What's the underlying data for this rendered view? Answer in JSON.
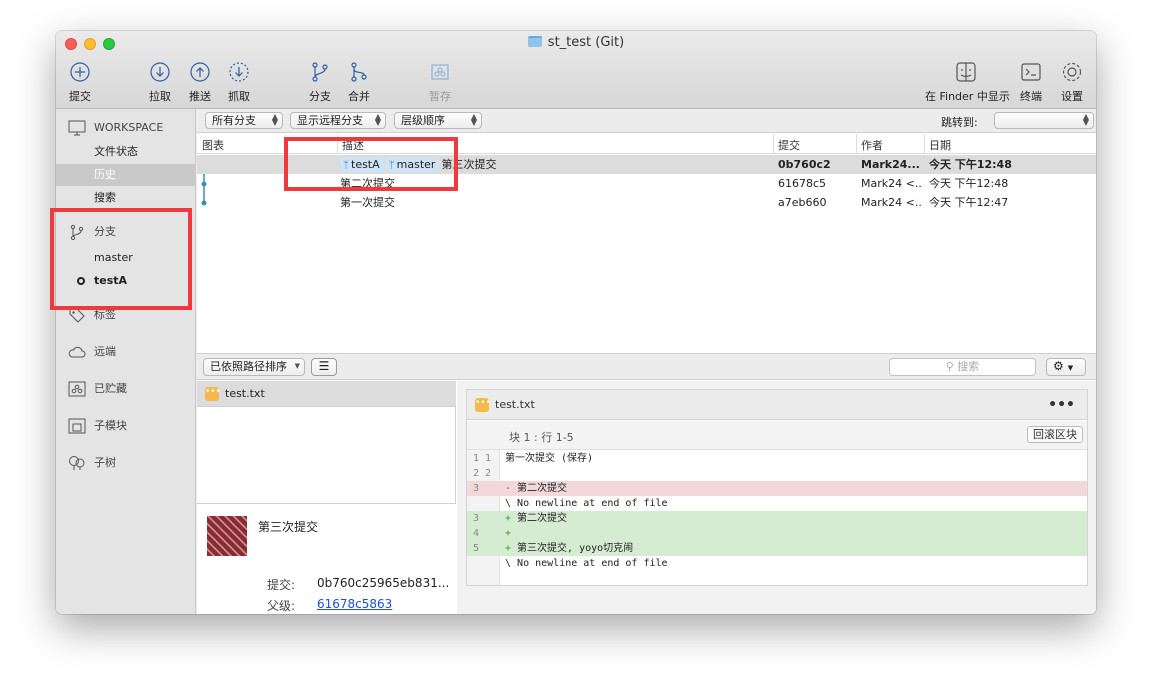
{
  "window": {
    "title": "st_test (Git)"
  },
  "toolbar": {
    "commit": "提交",
    "pull": "拉取",
    "push": "推送",
    "fetch": "抓取",
    "branch": "分支",
    "merge": "合并",
    "stash": "暂存",
    "show_in_finder": "在 Finder 中显示",
    "terminal": "终端",
    "settings": "设置"
  },
  "sidebar": {
    "workspace": "WORKSPACE",
    "file_status": "文件状态",
    "history": "历史",
    "search": "搜索",
    "branches": "分支",
    "branch_master": "master",
    "branch_testA": "testA",
    "tags": "标签",
    "remotes": "远端",
    "stashes": "已贮藏",
    "submodules": "子模块",
    "subtrees": "子树"
  },
  "filters": {
    "all_branches": "所有分支",
    "show_remote": "显示远程分支",
    "order": "层级顺序",
    "jump_to": "跳转到:"
  },
  "history": {
    "columns": {
      "graph": "图表",
      "description": "描述",
      "commit": "提交",
      "author": "作者",
      "date": "日期"
    },
    "rows": [
      {
        "tag1": "testA",
        "tag2": "master",
        "description": "第三次提交",
        "commit": "0b760c2",
        "author": "Mark24...",
        "date": "今天 下午12:48"
      },
      {
        "description": "第二次提交",
        "commit": "61678c5",
        "author": "Mark24 <...",
        "date": "今天 下午12:48"
      },
      {
        "description": "第一次提交",
        "commit": "a7eb660",
        "author": "Mark24 <...",
        "date": "今天 下午12:47"
      }
    ]
  },
  "lower": {
    "sort": "已依照路径排序",
    "search_placeholder": "搜索",
    "file_name": "test.txt"
  },
  "commit_info": {
    "title": "第三次提交",
    "commit_label": "提交:",
    "commit_value": "0b760c25965eb831...",
    "parent_label": "父级:",
    "parent_value": "61678c5863"
  },
  "diff": {
    "file_name": "test.txt",
    "hunk_title": "块 1 : 行 1-5",
    "revert": "回滚区块",
    "lines": [
      {
        "old": "1",
        "new": "1",
        "text": "第一次提交 (保存)"
      },
      {
        "old": "2",
        "new": "2",
        "text": ""
      },
      {
        "old": "3",
        "new": "",
        "mark": "-",
        "text": "第二次提交"
      },
      {
        "old": "",
        "new": "",
        "mark": "\\",
        "text": "No newline at end of file"
      },
      {
        "old": "",
        "new": "3",
        "mark": "+",
        "text": "第二次提交"
      },
      {
        "old": "",
        "new": "4",
        "mark": "+",
        "text": ""
      },
      {
        "old": "",
        "new": "5",
        "mark": "+",
        "text": "第三次提交, yoyo切克闹"
      },
      {
        "old": "",
        "new": "",
        "mark": "\\",
        "text": "No newline at end of file"
      }
    ]
  },
  "colors": {
    "highlight_box": "#f0393e",
    "branch_tag": "#cfe3f7",
    "diff_del": "#f2d8d8",
    "diff_add": "#d6ecd2",
    "link": "#1a4fd6"
  }
}
